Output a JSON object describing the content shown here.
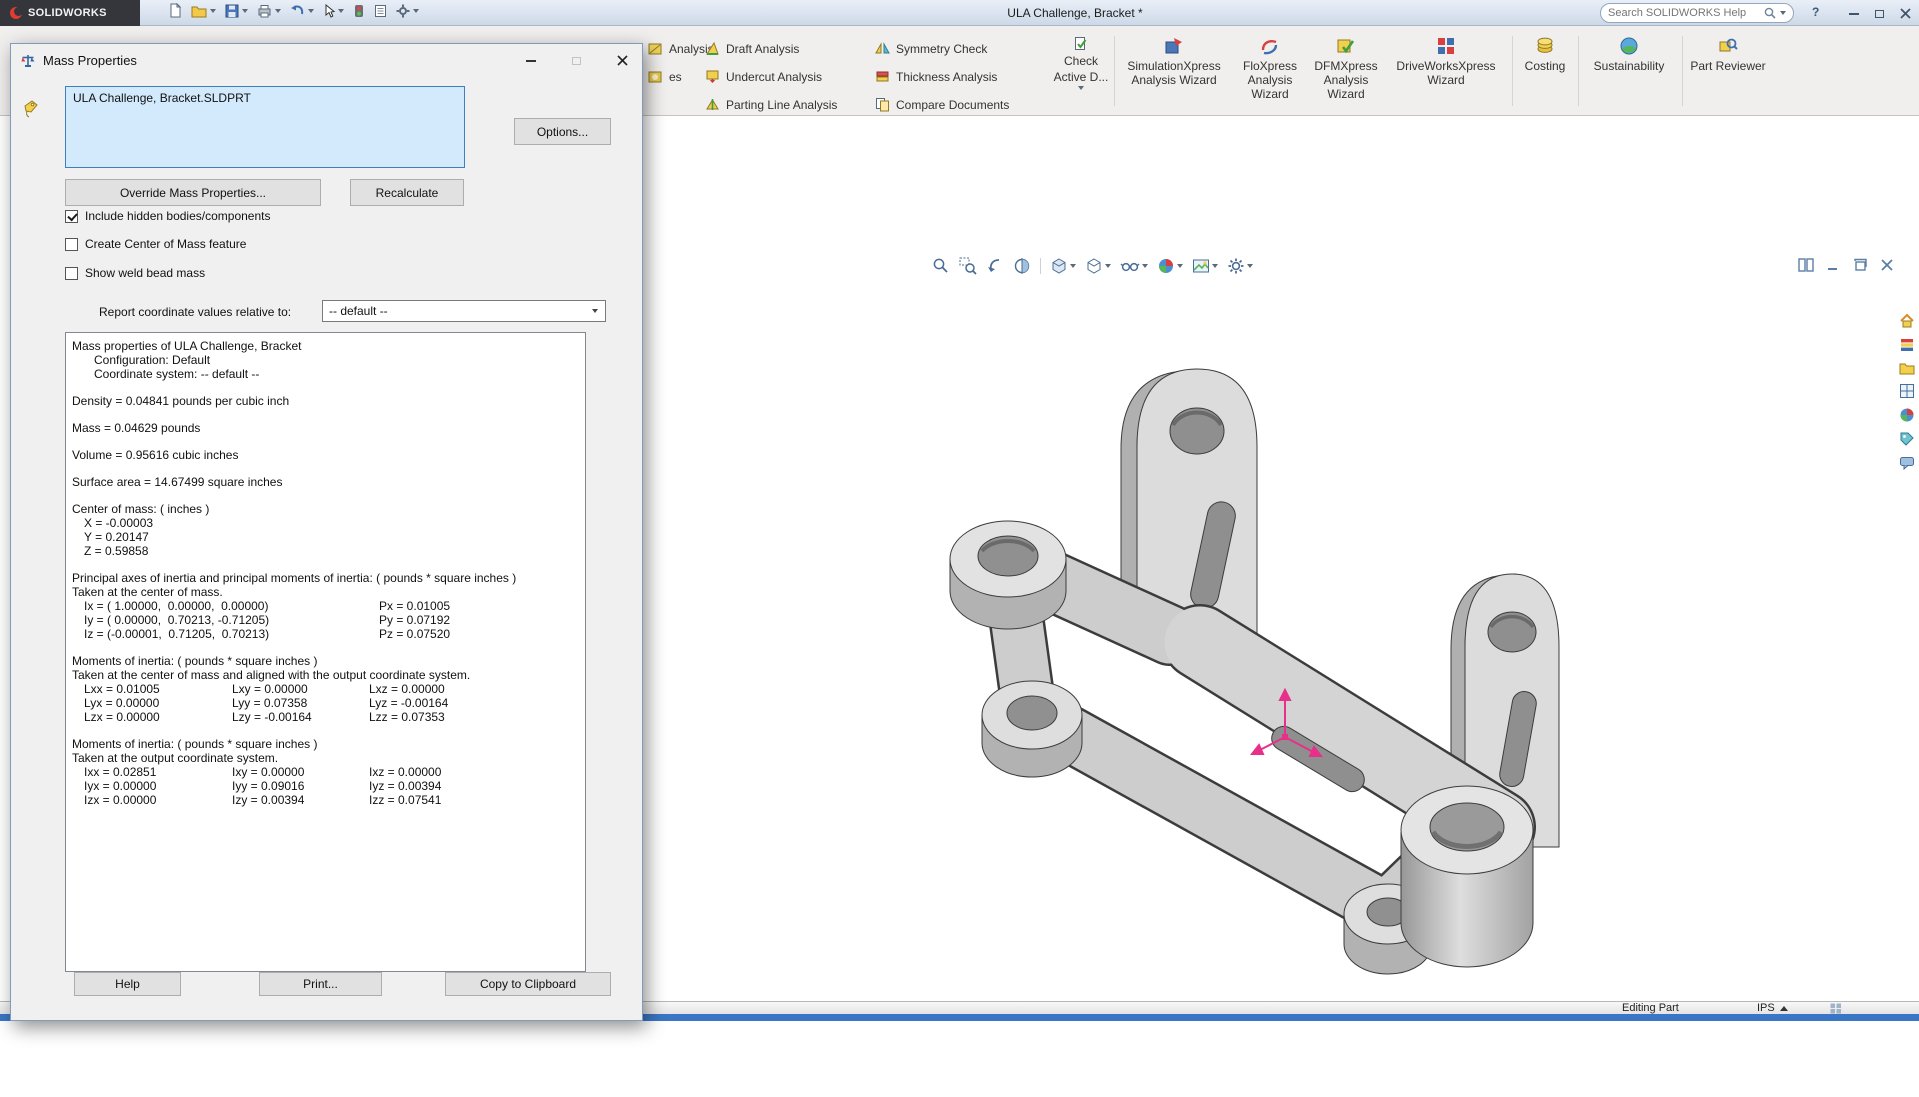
{
  "colors": {
    "accent_blue": "#3a76c5",
    "brand_red": "#e03c31",
    "selection_blue": "#d3eafc"
  },
  "titlebar": {
    "brand": "SOLIDWORKS",
    "title": "ULA Challenge, Bracket *",
    "search_placeholder": "Search SOLIDWORKS Help",
    "help_glyph": "?"
  },
  "ribbon": {
    "clipped": [
      "Analysis",
      "es"
    ],
    "mold": [
      "Draft Analysis",
      "Undercut Analysis",
      "Parting Line Analysis"
    ],
    "check": [
      "Symmetry Check",
      "Thickness Analysis",
      "Compare Documents"
    ],
    "check_active": {
      "line1": "Check",
      "line2": "Active D..."
    },
    "wizards": [
      {
        "label": "SimulationXpress Analysis Wizard",
        "icon": "simulationxpress-icon"
      },
      {
        "label": "FloXpress Analysis Wizard",
        "icon": "floxpress-icon"
      },
      {
        "label": "DFMXpress Analysis Wizard",
        "icon": "dfmxpress-icon"
      },
      {
        "label": "DriveWorksXpress Wizard",
        "icon": "driveworksxpress-icon"
      },
      {
        "label": "Costing",
        "icon": "costing-icon"
      },
      {
        "label": "Sustainability",
        "icon": "sustainability-icon"
      },
      {
        "label": "Part Reviewer",
        "icon": "part-reviewer-icon"
      }
    ]
  },
  "dialog": {
    "title": "Mass Properties",
    "filename": "ULA Challenge, Bracket.SLDPRT",
    "options_button": "Options...",
    "override_button": "Override Mass Properties...",
    "recalculate_button": "Recalculate",
    "checkboxes": [
      {
        "label": "Include hidden bodies/components",
        "checked": true
      },
      {
        "label": "Create Center of Mass feature",
        "checked": false
      },
      {
        "label": "Show weld bead mass",
        "checked": false
      }
    ],
    "report_label": "Report coordinate values relative to:",
    "report_value": "-- default --",
    "results": {
      "header": [
        "Mass properties of ULA Challenge, Bracket",
        "Configuration: Default",
        "Coordinate system: -- default --"
      ],
      "density": "Density = 0.04841 pounds per cubic inch",
      "mass": "Mass = 0.04629 pounds",
      "volume": "Volume = 0.95616 cubic inches",
      "surface_area": "Surface area = 14.67499 square inches",
      "com_header": "Center of mass: ( inches )",
      "com": [
        "X = -0.00003",
        "Y = 0.20147",
        "Z = 0.59858"
      ],
      "principal_header": "Principal axes of inertia and principal moments of inertia: ( pounds * square inches )",
      "principal_sub": "Taken at the center of mass.",
      "principal_rows": [
        {
          "axis": "Ix = ( 1.00000,  0.00000,  0.00000)",
          "moment": "Px = 0.01005"
        },
        {
          "axis": "Iy = ( 0.00000,  0.70213, -0.71205)",
          "moment": "Py = 0.07192"
        },
        {
          "axis": "Iz = (-0.00001,  0.71205,  0.70213)",
          "moment": "Pz = 0.07520"
        }
      ],
      "inertia_com_header": "Moments of inertia: ( pounds * square inches )",
      "inertia_com_sub": "Taken at the center of mass and aligned with the output coordinate system.",
      "inertia_com_rows": [
        [
          "Lxx = 0.01005",
          "Lxy = 0.00000",
          "Lxz = 0.00000"
        ],
        [
          "Lyx = 0.00000",
          "Lyy = 0.07358",
          "Lyz = -0.00164"
        ],
        [
          "Lzx = 0.00000",
          "Lzy = -0.00164",
          "Lzz = 0.07353"
        ]
      ],
      "inertia_out_header": "Moments of inertia: ( pounds * square inches )",
      "inertia_out_sub": "Taken at the output coordinate system.",
      "inertia_out_rows": [
        [
          "Ixx = 0.02851",
          "Ixy = 0.00000",
          "Ixz = 0.00000"
        ],
        [
          "Iyx = 0.00000",
          "Iyy = 0.09016",
          "Iyz = 0.00394"
        ],
        [
          "Izx = 0.00000",
          "Izy = 0.00394",
          "Izz = 0.07541"
        ]
      ]
    },
    "help_button": "Help",
    "print_button": "Print...",
    "copy_button": "Copy to Clipboard"
  },
  "statusbar": {
    "mode": "Editing Part",
    "units": "IPS"
  }
}
